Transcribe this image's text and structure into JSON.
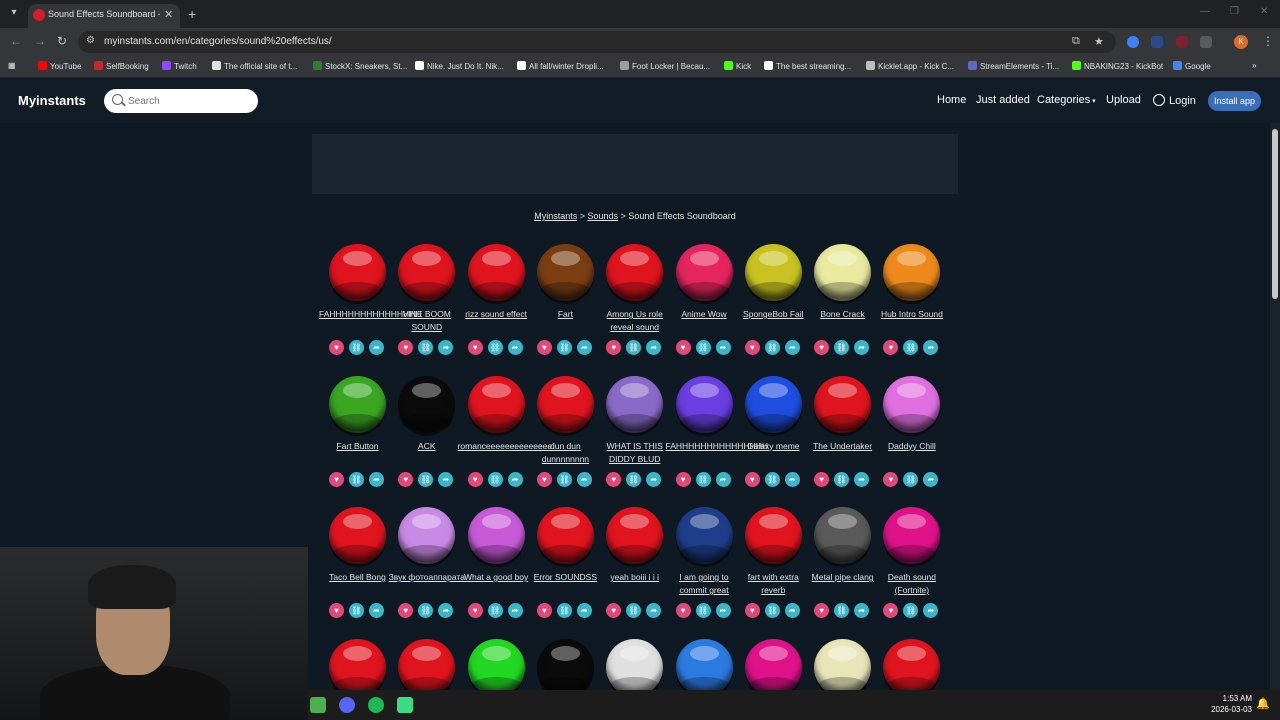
{
  "browser": {
    "tab_title": "Sound Effects Soundboard - In",
    "url": "myinstants.com/en/categories/sound%20effects/us/",
    "bookmarks": [
      {
        "label": "YouTube",
        "color": "#ff0000"
      },
      {
        "label": "SelfBooking",
        "color": "#c62828"
      },
      {
        "label": "Twitch",
        "color": "#9146ff"
      },
      {
        "label": "The official site of t...",
        "color": "#e0e0e0"
      },
      {
        "label": "StockX: Sneakers, St...",
        "color": "#2e7d32"
      },
      {
        "label": "Nike. Just Do It. Nik...",
        "color": "#ffffff"
      },
      {
        "label": "All fall/winter Dropli...",
        "color": "#ffffff"
      },
      {
        "label": "Foot Locker | Becau...",
        "color": "#9e9e9e"
      },
      {
        "label": "Kick",
        "color": "#53fc18"
      },
      {
        "label": "The best streaming...",
        "color": "#ffffff"
      },
      {
        "label": "Kicklet.app - Kick C...",
        "color": "#bdbdbd"
      },
      {
        "label": "StreamElements - Ti...",
        "color": "#5c6bc0"
      },
      {
        "label": "NBAKING23 - KickBot",
        "color": "#53fc18"
      },
      {
        "label": "Google",
        "color": "#4285f4"
      }
    ]
  },
  "site": {
    "logo": "Myinstants",
    "search_placeholder": "Search",
    "nav": {
      "home": "Home",
      "just_added": "Just added",
      "categories": "Categories",
      "upload": "Upload",
      "login": "Login",
      "install": "Install app"
    },
    "breadcrumb": {
      "home": "Myinstants",
      "sounds": "Sounds",
      "current": "Sound Effects Soundboard",
      "separator": ">"
    }
  },
  "buttons": [
    {
      "label": "FAHHHHHHHHHHHHHHH",
      "color": "#e0141e"
    },
    {
      "label": "VINE BOOM SOUND",
      "color": "#e0141e"
    },
    {
      "label": "rizz sound effect",
      "color": "#e0141e"
    },
    {
      "label": "Fart",
      "color": "#7a3e12"
    },
    {
      "label": "Among Us role reveal sound",
      "color": "#e0141e"
    },
    {
      "label": "Anime Wow",
      "color": "#e6245e"
    },
    {
      "label": "SpongeBob Fail",
      "color": "#c8c322"
    },
    {
      "label": "Bone Crack",
      "color": "#e9eaa0"
    },
    {
      "label": "Hub Intro Sound",
      "color": "#ee8a1c"
    },
    {
      "label": "Fart Button",
      "color": "#3aa622"
    },
    {
      "label": "ACK",
      "color": "#0b0b0b"
    },
    {
      "label": "romanceeeeeeeeeeeeee",
      "color": "#e0141e"
    },
    {
      "label": "dun dun dunnnnnnnn",
      "color": "#e0141e"
    },
    {
      "label": "WHAT IS THIS DIDDY BLUD",
      "color": "#8a6ac8"
    },
    {
      "label": "FAHHHHHHHHHHHHHHH",
      "color": "#6a3ee0"
    },
    {
      "label": "Galaxy meme",
      "color": "#1e4ee0"
    },
    {
      "label": "The Undertaker",
      "color": "#e0141e"
    },
    {
      "label": "Daddyy Chill",
      "color": "#e070e0"
    },
    {
      "label": "Taco Bell Bong",
      "color": "#e0141e"
    },
    {
      "label": "Звук фотоаппарата",
      "color": "#c98ae6"
    },
    {
      "label": "What a good boy",
      "color": "#c85ad8"
    },
    {
      "label": "Error SOUNDSS",
      "color": "#e0141e"
    },
    {
      "label": "yeah boiii i i i",
      "color": "#e0141e"
    },
    {
      "label": "I am going to commit great",
      "color": "#1e3e8a"
    },
    {
      "label": "fart with extra reverb",
      "color": "#e0141e"
    },
    {
      "label": "Metal pipe clang",
      "color": "#5a5a5a"
    },
    {
      "label": "Death sound (Fortnite)",
      "color": "#e0128a"
    },
    {
      "label": "",
      "color": "#e0141e"
    },
    {
      "label": "",
      "color": "#e0141e"
    },
    {
      "label": "",
      "color": "#22d822"
    },
    {
      "label": "",
      "color": "#0b0b0b"
    },
    {
      "label": "",
      "color": "#e0e0e0"
    },
    {
      "label": "",
      "color": "#2a7ae0"
    },
    {
      "label": "",
      "color": "#e0128a"
    },
    {
      "label": "",
      "color": "#e8e6b8"
    },
    {
      "label": "",
      "color": "#e0141e"
    }
  ],
  "taskbar": {
    "time": "1:53 AM",
    "date": "2026-03-03",
    "icons": [
      {
        "name": "minecraft-icon",
        "color": "#4caf50"
      },
      {
        "name": "discord-icon",
        "color": "#5865f2"
      },
      {
        "name": "spotify-icon",
        "color": "#1db954"
      },
      {
        "name": "app-icon",
        "color": "#3ddc84"
      }
    ]
  }
}
